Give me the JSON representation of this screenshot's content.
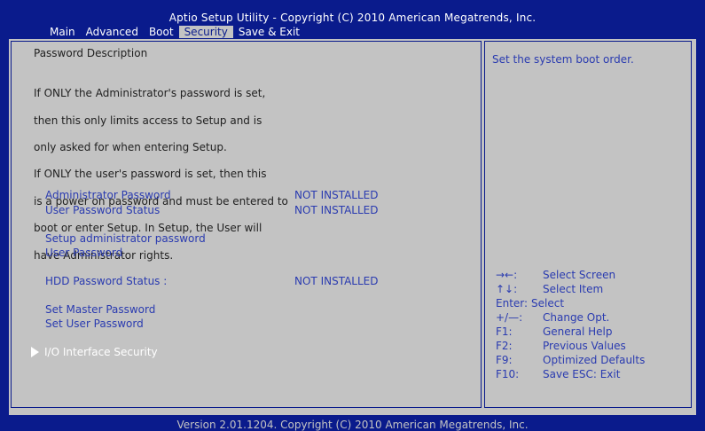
{
  "header": {
    "title": "Aptio Setup Utility - Copyright (C) 2010 American Megatrends, Inc.",
    "tabs": [
      "Main",
      "Advanced",
      "Boot",
      "Security",
      "Save & Exit"
    ],
    "active_tab": "Security"
  },
  "left": {
    "desc_title": "Password Description",
    "desc_lines": [
      "If ONLY the Administrator's password is set,",
      "then this only limits access to Setup and is",
      "only asked for when entering Setup.",
      "If ONLY the user's password is set, then this",
      "is a power on password and must be entered to",
      "boot or enter Setup. In Setup, the User will",
      "have Administrator rights."
    ],
    "admin_pw_label": "Administrator Password",
    "admin_pw_value": "NOT INSTALLED",
    "user_pw_status_label": "User Password Status",
    "user_pw_status_value": "NOT INSTALLED",
    "setup_admin_pw": "Setup administrator password",
    "user_password": "User Password",
    "hdd_status_label": "HDD Password Status :",
    "hdd_status_value": "NOT INSTALLED",
    "set_master_pw": "Set Master Password",
    "set_user_pw": "Set User Password",
    "io_security": "I/O Interface Security"
  },
  "right": {
    "help": "Set the system boot order.",
    "keys": [
      {
        "key": "→←:",
        "desc": "Select Screen"
      },
      {
        "key": "↑↓:",
        "desc": "Select Item"
      },
      {
        "key": "Enter:",
        "desc": "Select"
      },
      {
        "key": "+/—:",
        "desc": "Change Opt."
      },
      {
        "key": "F1:",
        "desc": "General Help"
      },
      {
        "key": "F2:",
        "desc": "Previous Values"
      },
      {
        "key": "F9:",
        "desc": "Optimized Defaults"
      },
      {
        "key": "F10:",
        "desc": "Save  ESC: Exit"
      }
    ]
  },
  "footer": "Version 2.01.1204. Copyright (C) 2010 American Megatrends, Inc.",
  "colors": {
    "background": "#0a1b8c",
    "panel": "#c3c3c3",
    "item_text": "#2a3bb0",
    "text": "#1f1f1f",
    "selected_text": "#ffffff"
  }
}
